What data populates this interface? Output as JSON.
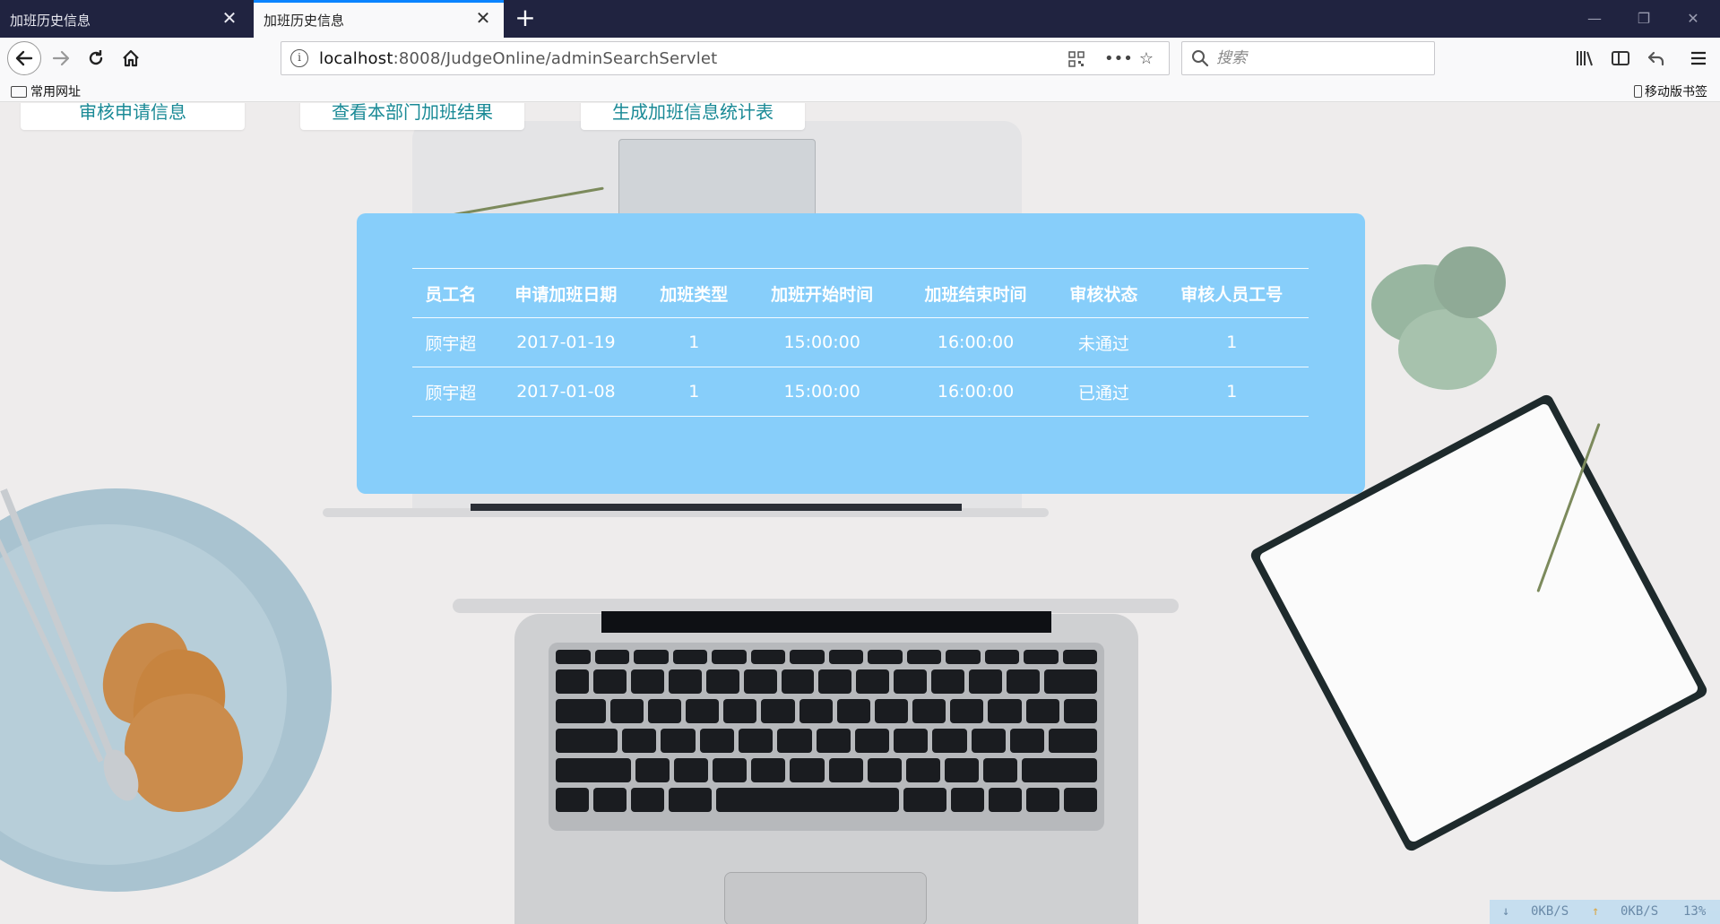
{
  "browser": {
    "tabs": [
      {
        "title": "加班历史信息",
        "active": false
      },
      {
        "title": "加班历史信息",
        "active": true
      }
    ],
    "url": {
      "host": "localhost",
      "rest": ":8008/JudgeOnline/adminSearchServlet"
    },
    "search_placeholder": "搜索",
    "bookmarks": {
      "folder": "常用网址",
      "mobile": "移动版书签"
    },
    "accent": "#0a84ff"
  },
  "nav_buttons": [
    "审核申请信息",
    "查看本部门加班结果",
    "生成加班信息统计表"
  ],
  "table": {
    "headers": [
      "员工名",
      "申请加班日期",
      "加班类型",
      "加班开始时间",
      "加班结束时间",
      "审核状态",
      "审核人员工号"
    ],
    "rows": [
      [
        "顾宇超",
        "2017-01-19",
        "1",
        "15:00:00",
        "16:00:00",
        "未通过",
        "1"
      ],
      [
        "顾宇超",
        "2017-01-08",
        "1",
        "15:00:00",
        "16:00:00",
        "已通过",
        "1"
      ]
    ]
  },
  "panel_color": "#87cefa",
  "button_text_color": "#1a8a96",
  "netmon": {
    "down": "0KB/S",
    "up": "0KB/S",
    "percent": "13%"
  }
}
